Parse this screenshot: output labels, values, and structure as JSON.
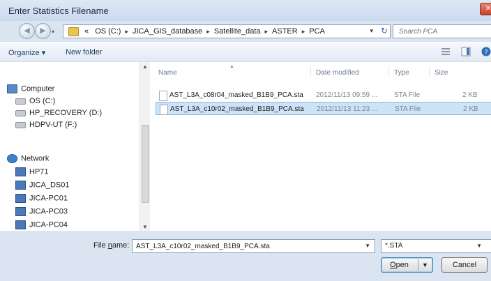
{
  "window": {
    "title": "Enter Statistics Filename",
    "close_glyph": "✕"
  },
  "nav": {
    "back_glyph": "◀",
    "forward_glyph": "▶"
  },
  "address": {
    "prefix": "«",
    "crumbs": [
      "OS (C:)",
      "JICA_GIS_database",
      "Satellite_data",
      "ASTER",
      "PCA"
    ],
    "separator": "▸",
    "dropdown_glyph": "▾",
    "refresh_glyph": "↻"
  },
  "search": {
    "placeholder": "Search PCA"
  },
  "toolbar": {
    "organize_label": "Organize ▾",
    "new_folder_label": "New folder"
  },
  "sidebar": {
    "computer": "Computer",
    "drives": [
      "OS (C:)",
      "HP_RECOVERY (D:)",
      "HDPV-UT (F:)"
    ],
    "network": "Network",
    "network_items": [
      "HP71",
      "JICA_DS01",
      "JICA-PC01",
      "JICA-PC03",
      "JICA-PC04"
    ]
  },
  "file_list": {
    "columns": {
      "name": "Name",
      "date": "Date modified",
      "type": "Type",
      "size": "Size"
    },
    "rows": [
      {
        "name": "AST_L3A_c08r04_masked_B1B9_PCA.sta",
        "date": "2012/11/13 09:59 ...",
        "type": "STA File",
        "size": "2 KB",
        "selected": false
      },
      {
        "name": "AST_L3A_c10r02_masked_B1B9_PCA.sta",
        "date": "2012/11/13 11:23 ...",
        "type": "STA File",
        "size": "2 KB",
        "selected": true
      }
    ]
  },
  "bottom": {
    "filename_label_prefix": "File ",
    "filename_label_underlined": "n",
    "filename_label_suffix": "ame:",
    "filename_value": "AST_L3A_c10r02_masked_B1B9_PCA.sta",
    "file_type_value": "*.STA",
    "open_label_underlined": "O",
    "open_label_rest": "pen",
    "cancel_label": "Cancel"
  }
}
